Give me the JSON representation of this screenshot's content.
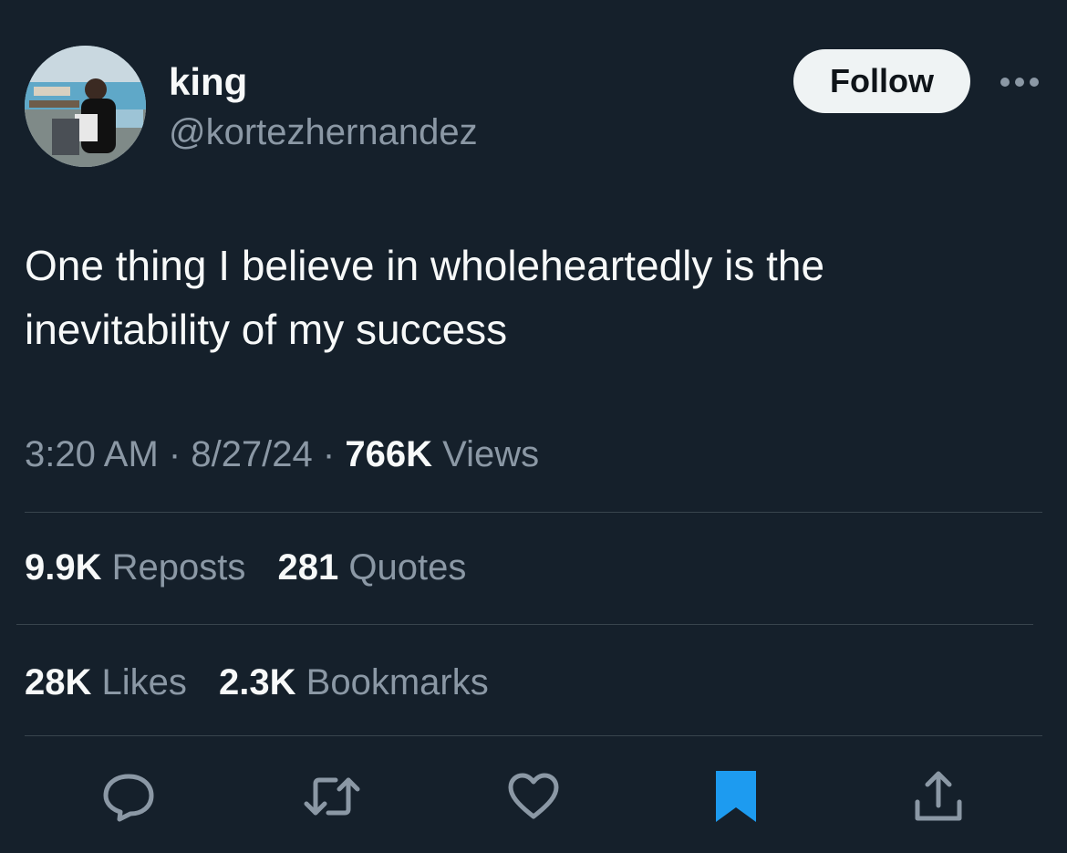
{
  "author": {
    "display_name": "king",
    "handle": "@kortezhernandez"
  },
  "follow_label": "Follow",
  "tweet": {
    "text": "One thing I believe in wholeheartedly is the inevitability of my success",
    "time": "3:20 AM",
    "date": "8/27/24",
    "views_count": "766K",
    "views_label": "Views"
  },
  "stats": {
    "reposts": {
      "count": "9.9K",
      "label": "Reposts"
    },
    "quotes": {
      "count": "281",
      "label": "Quotes"
    },
    "likes": {
      "count": "28K",
      "label": "Likes"
    },
    "bookmarks": {
      "count": "2.3K",
      "label": "Bookmarks"
    }
  },
  "actions": {
    "icons": [
      "reply-icon",
      "retweet-icon",
      "like-icon",
      "bookmark-icon",
      "share-icon"
    ],
    "bookmarked": true
  },
  "colors": {
    "background": "#15202b",
    "text": "#f7f9f9",
    "secondary_text": "#8b98a5",
    "divider": "#38444d",
    "accent": "#1d9bf0",
    "follow_button_bg": "#eff3f4"
  }
}
